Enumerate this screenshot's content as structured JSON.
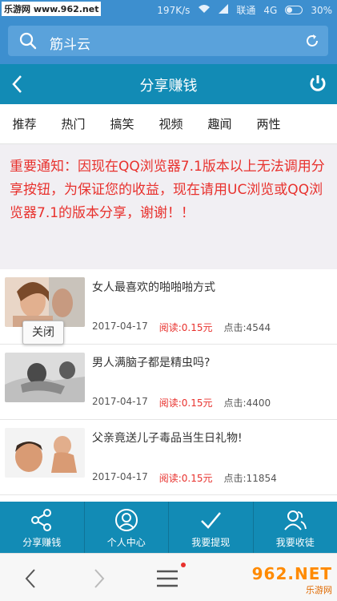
{
  "status_bar": {
    "watermark": "乐游网 www.962.net",
    "speed": "197K/s",
    "carrier": "联通",
    "network": "4G",
    "battery": "30%"
  },
  "search": {
    "query": "筋斗云"
  },
  "header": {
    "title": "分享赚钱"
  },
  "tabs": [
    "推荐",
    "热门",
    "搞笑",
    "视频",
    "趣闻",
    "两性"
  ],
  "notice": {
    "text": "重要通知：因现在QQ浏览器7.1版本以上无法调用分享按钮，为保证您的收益，现在请用UC浏览或QQ浏览器7.1的版本分享，谢谢！！"
  },
  "articles": [
    {
      "title": "女人最喜欢的啪啪啪方式",
      "date": "2017-04-17",
      "reward": "阅读:0.15元",
      "clicks": "点击:4544"
    },
    {
      "title": "男人满脑子都是精虫吗?",
      "date": "2017-04-17",
      "reward": "阅读:0.15元",
      "clicks": "点击:4400"
    },
    {
      "title": "父亲竟送儿子毒品当生日礼物!",
      "date": "2017-04-17",
      "reward": "阅读:0.15元",
      "clicks": "点击:11854"
    }
  ],
  "close_tooltip": "关闭",
  "bottom_nav": [
    {
      "label": "分享赚钱",
      "icon": "share-icon"
    },
    {
      "label": "个人中心",
      "icon": "user-icon"
    },
    {
      "label": "我要提现",
      "icon": "check-icon"
    },
    {
      "label": "我要收徒",
      "icon": "users-icon"
    }
  ],
  "brand": {
    "logo": "962.NET",
    "sub": "乐游网"
  },
  "colors": {
    "primary": "#128bb5",
    "status": "#3d8fcf",
    "alert": "#e8312d"
  }
}
